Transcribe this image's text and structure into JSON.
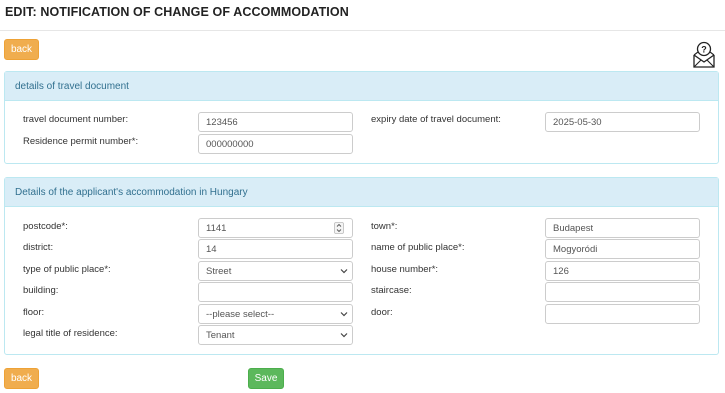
{
  "page": {
    "title": "EDIT: NOTIFICATION OF CHANGE OF ACCOMMODATION"
  },
  "buttons": {
    "back_label": "back",
    "save_label": "Save"
  },
  "travel_document": {
    "heading": "details of travel document",
    "number_label": "travel document number:",
    "number_value": "123456",
    "expiry_label": "expiry date of travel document:",
    "expiry_value": "2025-05-30",
    "permit_label": "Residence permit number*:",
    "permit_value": "000000000"
  },
  "accommodation": {
    "heading": "Details of the applicant's accommodation in Hungary",
    "postcode_label": "postcode*:",
    "postcode_value": "1141",
    "town_label": "town*:",
    "town_value": "Budapest",
    "district_label": "district:",
    "district_value": "14",
    "public_place_name_label": "name of public place*:",
    "public_place_name_value": "Mogyoródi",
    "public_place_type_label": "type of public place*:",
    "public_place_type_value": "Street",
    "house_number_label": "house number*:",
    "house_number_value": "126",
    "building_label": "building:",
    "building_value": "",
    "staircase_label": "staircase:",
    "staircase_value": "",
    "floor_label": "floor:",
    "floor_value": "--please select--",
    "door_label": "door:",
    "door_value": "",
    "legal_title_label": "legal title of residence:",
    "legal_title_value": "Tenant"
  },
  "icons": {
    "help": "envelope-question-icon"
  },
  "colors": {
    "back_button": "#f0ad4e",
    "save_button": "#5cb85c",
    "panel_heading_bg": "#d9edf7",
    "panel_heading_text": "#31708f"
  }
}
